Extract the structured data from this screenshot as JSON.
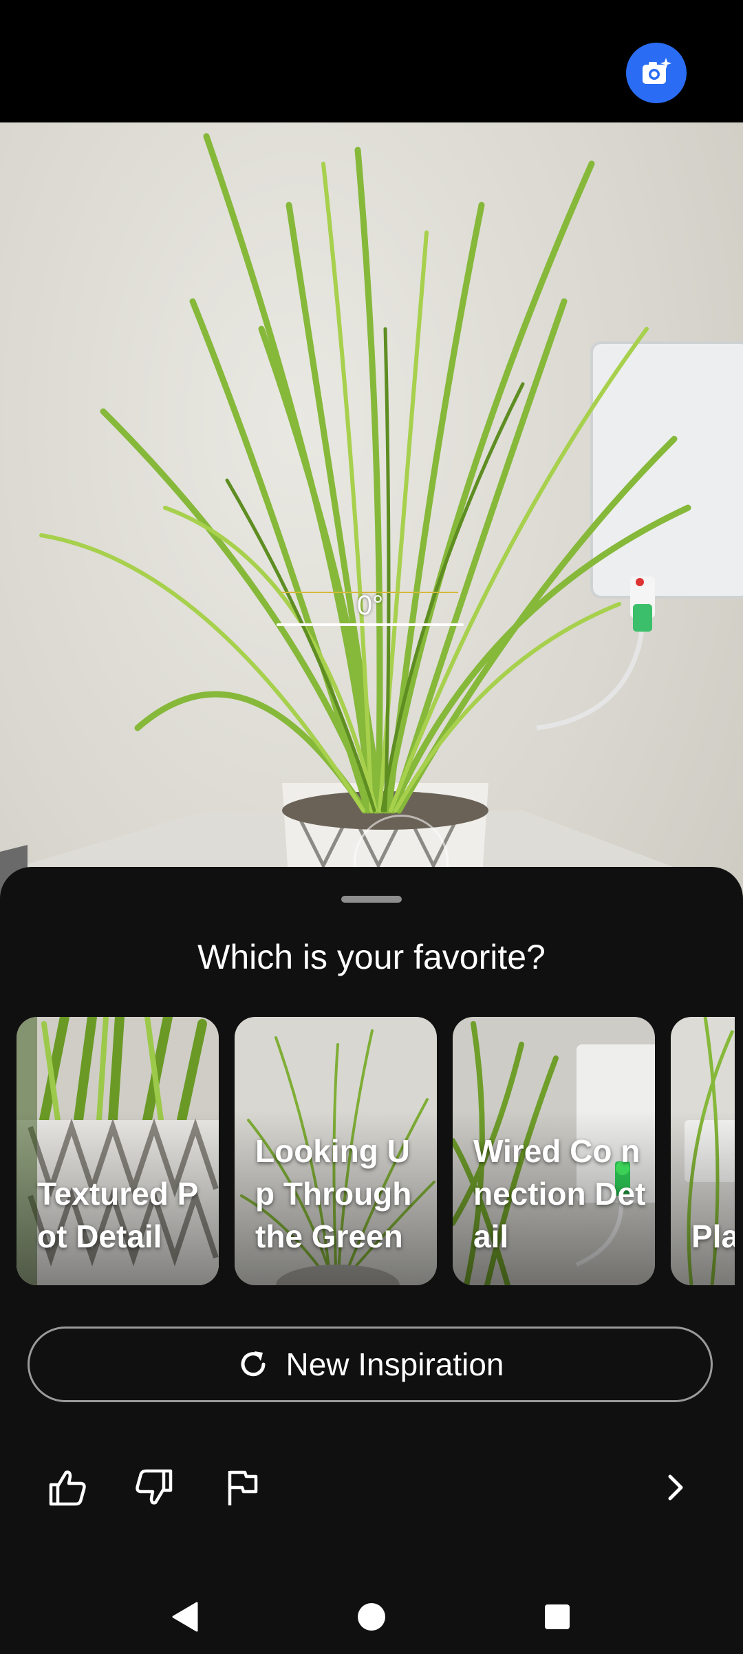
{
  "camera": {
    "ai_button_icon": "camera-sparkle-icon",
    "level_readout": "0°",
    "accent_color": "#2a6df4"
  },
  "sheet": {
    "title": "Which is your favorite?",
    "cards": [
      {
        "label": "Textured Pot Detail"
      },
      {
        "label": "Looking Up Through the Green"
      },
      {
        "label": "Wired Co nnection Detail"
      },
      {
        "label": "Pla Co"
      }
    ],
    "new_inspiration_label": "New Inspiration",
    "feedback": {
      "thumbs_up_icon": "thumbs-up-icon",
      "thumbs_down_icon": "thumbs-down-icon",
      "flag_icon": "flag-icon",
      "next_icon": "chevron-right-icon"
    }
  },
  "navigation": {
    "back_icon": "back-icon",
    "home_icon": "home-icon",
    "recents_icon": "recents-icon"
  }
}
